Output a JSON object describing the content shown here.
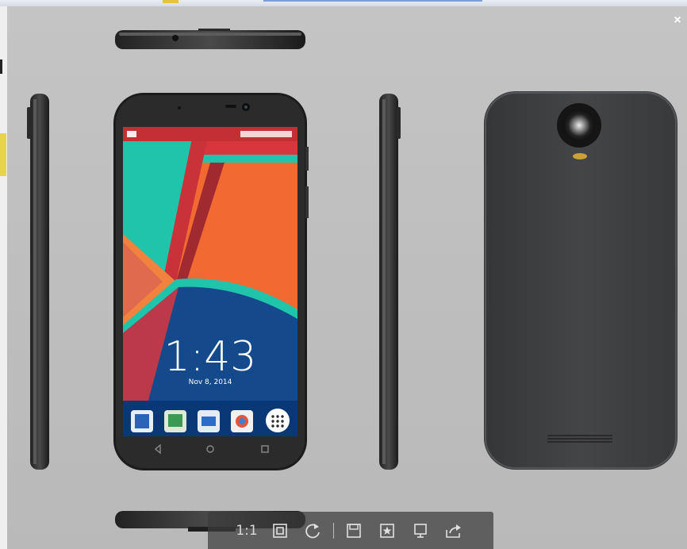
{
  "viewer": {
    "close_label": "×",
    "toolbar": [
      {
        "name": "actual-size-button",
        "label": "1:1",
        "icon": "actual-size"
      },
      {
        "name": "fit-window-button",
        "icon": "fit-window-icon"
      },
      {
        "name": "rotate-button",
        "icon": "rotate-icon"
      },
      {
        "name": "save-button",
        "icon": "save-icon"
      },
      {
        "name": "favorite-button",
        "icon": "star-icon"
      },
      {
        "name": "slideshow-button",
        "icon": "monitor-icon"
      },
      {
        "name": "share-button",
        "icon": "share-icon"
      }
    ]
  },
  "phone_screen": {
    "time": "1:43",
    "date": "Nov 8, 2014"
  },
  "colors": {
    "teal": "#20c4aa",
    "orange": "#f26a31",
    "red": "#d8363c",
    "blue": "#144a8c",
    "body_dark": "#3c3d3f"
  }
}
